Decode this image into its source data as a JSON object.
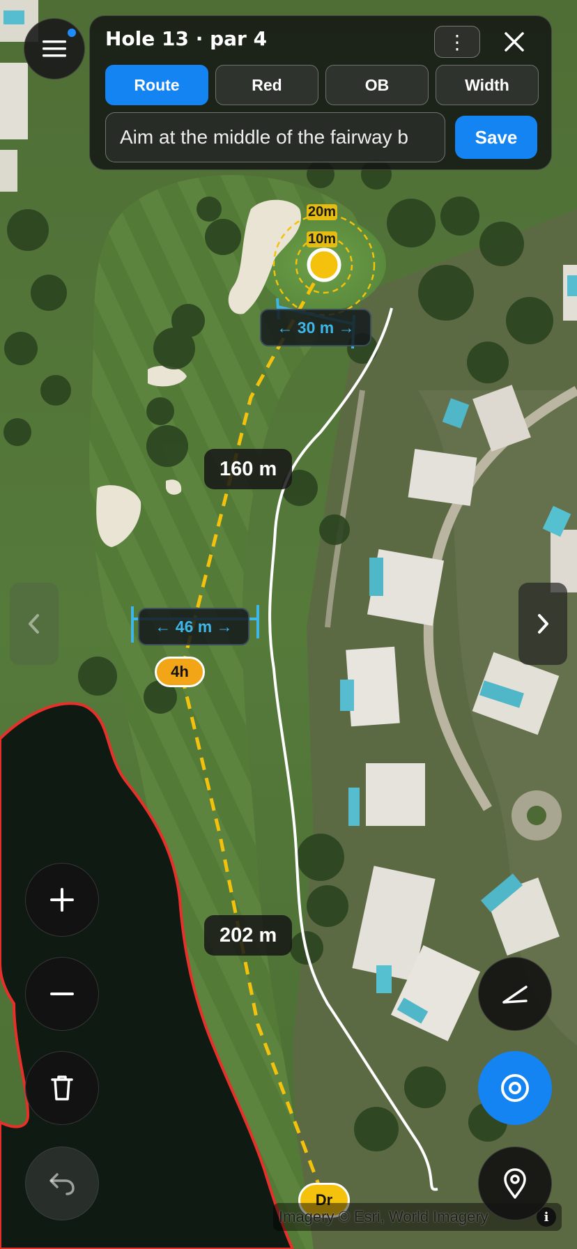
{
  "header": {
    "hole_title": "Hole 13 · par 4",
    "more_glyph": "⋮",
    "close_icon": "close-icon",
    "tabs": [
      {
        "label": "Route",
        "active": true
      },
      {
        "label": "Red",
        "active": false
      },
      {
        "label": "OB",
        "active": false
      },
      {
        "label": "Width",
        "active": false
      }
    ],
    "note_value": "Aim at the middle of the fairway b",
    "save_label": "Save"
  },
  "map": {
    "distances": [
      "160 m",
      "202 m"
    ],
    "widths": [
      "← 30 m →",
      "← 46 m →"
    ],
    "green_rings": [
      "20m",
      "10m"
    ],
    "clubs": [
      "4h",
      "Dr"
    ],
    "attribution": "Imagery © Esri, World Imagery",
    "info_glyph": "i"
  },
  "controls": {
    "menu_icon": "hamburger-icon",
    "zoom_in_icon": "plus-icon",
    "zoom_out_icon": "minus-icon",
    "delete_icon": "trash-icon",
    "undo_icon": "undo-icon",
    "draw_icon": "draw-line-icon",
    "target_icon": "target-icon",
    "location_icon": "location-pin-icon",
    "prev_icon": "chevron-left-icon",
    "next_icon": "chevron-right-icon"
  },
  "colors": {
    "accent": "#1584f3",
    "route_line": "#f4c20d",
    "hazard_outline": "#e8302a",
    "ob_line": "#ffffff",
    "width_marker": "#3fb6e8",
    "club_badge": "#f2a516"
  }
}
